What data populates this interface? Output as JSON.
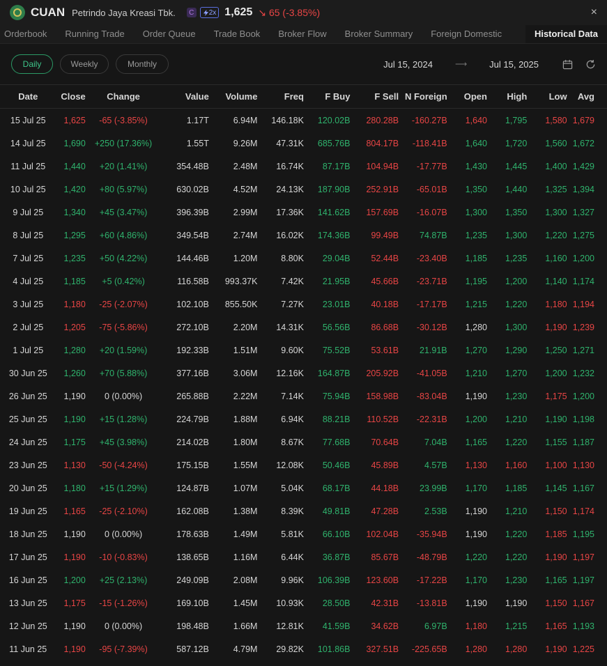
{
  "header": {
    "ticker": "CUAN",
    "company": "Petrindo Jaya Kreasi Tbk.",
    "badge_c": "C",
    "badge_2x": "2x",
    "price": "1,625",
    "change": "↘ 65 (-3.85%)",
    "close_icon": "×"
  },
  "tabs": [
    "Orderbook",
    "Running Trade",
    "Order Queue",
    "Trade Book",
    "Broker Flow",
    "Broker Summary",
    "Foreign Domestic",
    "Historical Data"
  ],
  "active_tab": "Historical Data",
  "periods": [
    "Daily",
    "Weekly",
    "Monthly"
  ],
  "active_period": "Daily",
  "date_range": {
    "from": "Jul 15, 2024",
    "to": "Jul 15, 2025"
  },
  "colors": {
    "green": "#2fb36d",
    "red": "#e84545",
    "neutral": "#d6d6d6",
    "accent": "#3ec58a"
  },
  "columns": [
    "Date",
    "Close",
    "Change",
    "Value",
    "Volume",
    "Freq",
    "F Buy",
    "F Sell",
    "N Foreign",
    "Open",
    "High",
    "Low",
    "Avg"
  ],
  "rows": [
    {
      "date": "15 Jul 25",
      "close": "1,625",
      "change": "-65 (-3.85%)",
      "value": "1.17T",
      "volume": "6.94M",
      "freq": "146.18K",
      "fbuy": "120.02B",
      "fsell": "280.28B",
      "nforeign": "-160.27B",
      "open": "1,640",
      "high": "1,795",
      "low": "1,580",
      "avg": "1,679"
    },
    {
      "date": "14 Jul 25",
      "close": "1,690",
      "change": "+250 (17.36%)",
      "value": "1.55T",
      "volume": "9.26M",
      "freq": "47.31K",
      "fbuy": "685.76B",
      "fsell": "804.17B",
      "nforeign": "-118.41B",
      "open": "1,640",
      "high": "1,720",
      "low": "1,560",
      "avg": "1,672"
    },
    {
      "date": "11 Jul 25",
      "close": "1,440",
      "change": "+20 (1.41%)",
      "value": "354.48B",
      "volume": "2.48M",
      "freq": "16.74K",
      "fbuy": "87.17B",
      "fsell": "104.94B",
      "nforeign": "-17.77B",
      "open": "1,430",
      "high": "1,445",
      "low": "1,400",
      "avg": "1,429"
    },
    {
      "date": "10 Jul 25",
      "close": "1,420",
      "change": "+80 (5.97%)",
      "value": "630.02B",
      "volume": "4.52M",
      "freq": "24.13K",
      "fbuy": "187.90B",
      "fsell": "252.91B",
      "nforeign": "-65.01B",
      "open": "1,350",
      "high": "1,440",
      "low": "1,325",
      "avg": "1,394"
    },
    {
      "date": "9 Jul 25",
      "close": "1,340",
      "change": "+45 (3.47%)",
      "value": "396.39B",
      "volume": "2.99M",
      "freq": "17.36K",
      "fbuy": "141.62B",
      "fsell": "157.69B",
      "nforeign": "-16.07B",
      "open": "1,300",
      "high": "1,350",
      "low": "1,300",
      "avg": "1,327"
    },
    {
      "date": "8 Jul 25",
      "close": "1,295",
      "change": "+60 (4.86%)",
      "value": "349.54B",
      "volume": "2.74M",
      "freq": "16.02K",
      "fbuy": "174.36B",
      "fsell": "99.49B",
      "nforeign": "74.87B",
      "open": "1,235",
      "high": "1,300",
      "low": "1,220",
      "avg": "1,275"
    },
    {
      "date": "7 Jul 25",
      "close": "1,235",
      "change": "+50 (4.22%)",
      "value": "144.46B",
      "volume": "1.20M",
      "freq": "8.80K",
      "fbuy": "29.04B",
      "fsell": "52.44B",
      "nforeign": "-23.40B",
      "open": "1,185",
      "high": "1,235",
      "low": "1,160",
      "avg": "1,200"
    },
    {
      "date": "4 Jul 25",
      "close": "1,185",
      "change": "+5 (0.42%)",
      "value": "116.58B",
      "volume": "993.37K",
      "freq": "7.42K",
      "fbuy": "21.95B",
      "fsell": "45.66B",
      "nforeign": "-23.71B",
      "open": "1,195",
      "high": "1,200",
      "low": "1,140",
      "avg": "1,174"
    },
    {
      "date": "3 Jul 25",
      "close": "1,180",
      "change": "-25 (-2.07%)",
      "value": "102.10B",
      "volume": "855.50K",
      "freq": "7.27K",
      "fbuy": "23.01B",
      "fsell": "40.18B",
      "nforeign": "-17.17B",
      "open": "1,215",
      "high": "1,220",
      "low": "1,180",
      "avg": "1,194"
    },
    {
      "date": "2 Jul 25",
      "close": "1,205",
      "change": "-75 (-5.86%)",
      "value": "272.10B",
      "volume": "2.20M",
      "freq": "14.31K",
      "fbuy": "56.56B",
      "fsell": "86.68B",
      "nforeign": "-30.12B",
      "open": "1,280",
      "high": "1,300",
      "low": "1,190",
      "avg": "1,239"
    },
    {
      "date": "1 Jul 25",
      "close": "1,280",
      "change": "+20 (1.59%)",
      "value": "192.33B",
      "volume": "1.51M",
      "freq": "9.60K",
      "fbuy": "75.52B",
      "fsell": "53.61B",
      "nforeign": "21.91B",
      "open": "1,270",
      "high": "1,290",
      "low": "1,250",
      "avg": "1,271"
    },
    {
      "date": "30 Jun 25",
      "close": "1,260",
      "change": "+70 (5.88%)",
      "value": "377.16B",
      "volume": "3.06M",
      "freq": "12.16K",
      "fbuy": "164.87B",
      "fsell": "205.92B",
      "nforeign": "-41.05B",
      "open": "1,210",
      "high": "1,270",
      "low": "1,200",
      "avg": "1,232"
    },
    {
      "date": "26 Jun 25",
      "close": "1,190",
      "change": "0 (0.00%)",
      "value": "265.88B",
      "volume": "2.22M",
      "freq": "7.14K",
      "fbuy": "75.94B",
      "fsell": "158.98B",
      "nforeign": "-83.04B",
      "open": "1,190",
      "high": "1,230",
      "low": "1,175",
      "avg": "1,200"
    },
    {
      "date": "25 Jun 25",
      "close": "1,190",
      "change": "+15 (1.28%)",
      "value": "224.79B",
      "volume": "1.88M",
      "freq": "6.94K",
      "fbuy": "88.21B",
      "fsell": "110.52B",
      "nforeign": "-22.31B",
      "open": "1,200",
      "high": "1,210",
      "low": "1,190",
      "avg": "1,198"
    },
    {
      "date": "24 Jun 25",
      "close": "1,175",
      "change": "+45 (3.98%)",
      "value": "214.02B",
      "volume": "1.80M",
      "freq": "8.67K",
      "fbuy": "77.68B",
      "fsell": "70.64B",
      "nforeign": "7.04B",
      "open": "1,165",
      "high": "1,220",
      "low": "1,155",
      "avg": "1,187"
    },
    {
      "date": "23 Jun 25",
      "close": "1,130",
      "change": "-50 (-4.24%)",
      "value": "175.15B",
      "volume": "1.55M",
      "freq": "12.08K",
      "fbuy": "50.46B",
      "fsell": "45.89B",
      "nforeign": "4.57B",
      "open": "1,130",
      "high": "1,160",
      "low": "1,100",
      "avg": "1,130"
    },
    {
      "date": "20 Jun 25",
      "close": "1,180",
      "change": "+15 (1.29%)",
      "value": "124.87B",
      "volume": "1.07M",
      "freq": "5.04K",
      "fbuy": "68.17B",
      "fsell": "44.18B",
      "nforeign": "23.99B",
      "open": "1,170",
      "high": "1,185",
      "low": "1,145",
      "avg": "1,167"
    },
    {
      "date": "19 Jun 25",
      "close": "1,165",
      "change": "-25 (-2.10%)",
      "value": "162.08B",
      "volume": "1.38M",
      "freq": "8.39K",
      "fbuy": "49.81B",
      "fsell": "47.28B",
      "nforeign": "2.53B",
      "open": "1,190",
      "high": "1,210",
      "low": "1,150",
      "avg": "1,174"
    },
    {
      "date": "18 Jun 25",
      "close": "1,190",
      "change": "0 (0.00%)",
      "value": "178.63B",
      "volume": "1.49M",
      "freq": "5.81K",
      "fbuy": "66.10B",
      "fsell": "102.04B",
      "nforeign": "-35.94B",
      "open": "1,190",
      "high": "1,220",
      "low": "1,185",
      "avg": "1,195"
    },
    {
      "date": "17 Jun 25",
      "close": "1,190",
      "change": "-10 (-0.83%)",
      "value": "138.65B",
      "volume": "1.16M",
      "freq": "6.44K",
      "fbuy": "36.87B",
      "fsell": "85.67B",
      "nforeign": "-48.79B",
      "open": "1,220",
      "high": "1,220",
      "low": "1,190",
      "avg": "1,197"
    },
    {
      "date": "16 Jun 25",
      "close": "1,200",
      "change": "+25 (2.13%)",
      "value": "249.09B",
      "volume": "2.08M",
      "freq": "9.96K",
      "fbuy": "106.39B",
      "fsell": "123.60B",
      "nforeign": "-17.22B",
      "open": "1,170",
      "high": "1,230",
      "low": "1,165",
      "avg": "1,197"
    },
    {
      "date": "13 Jun 25",
      "close": "1,175",
      "change": "-15 (-1.26%)",
      "value": "169.10B",
      "volume": "1.45M",
      "freq": "10.93K",
      "fbuy": "28.50B",
      "fsell": "42.31B",
      "nforeign": "-13.81B",
      "open": "1,190",
      "high": "1,190",
      "low": "1,150",
      "avg": "1,167"
    },
    {
      "date": "12 Jun 25",
      "close": "1,190",
      "change": "0 (0.00%)",
      "value": "198.48B",
      "volume": "1.66M",
      "freq": "12.81K",
      "fbuy": "41.59B",
      "fsell": "34.62B",
      "nforeign": "6.97B",
      "open": "1,180",
      "high": "1,215",
      "low": "1,165",
      "avg": "1,193"
    },
    {
      "date": "11 Jun 25",
      "close": "1,190",
      "change": "-95 (-7.39%)",
      "value": "587.12B",
      "volume": "4.79M",
      "freq": "29.82K",
      "fbuy": "101.86B",
      "fsell": "327.51B",
      "nforeign": "-225.65B",
      "open": "1,280",
      "high": "1,280",
      "low": "1,190",
      "avg": "1,225"
    }
  ]
}
